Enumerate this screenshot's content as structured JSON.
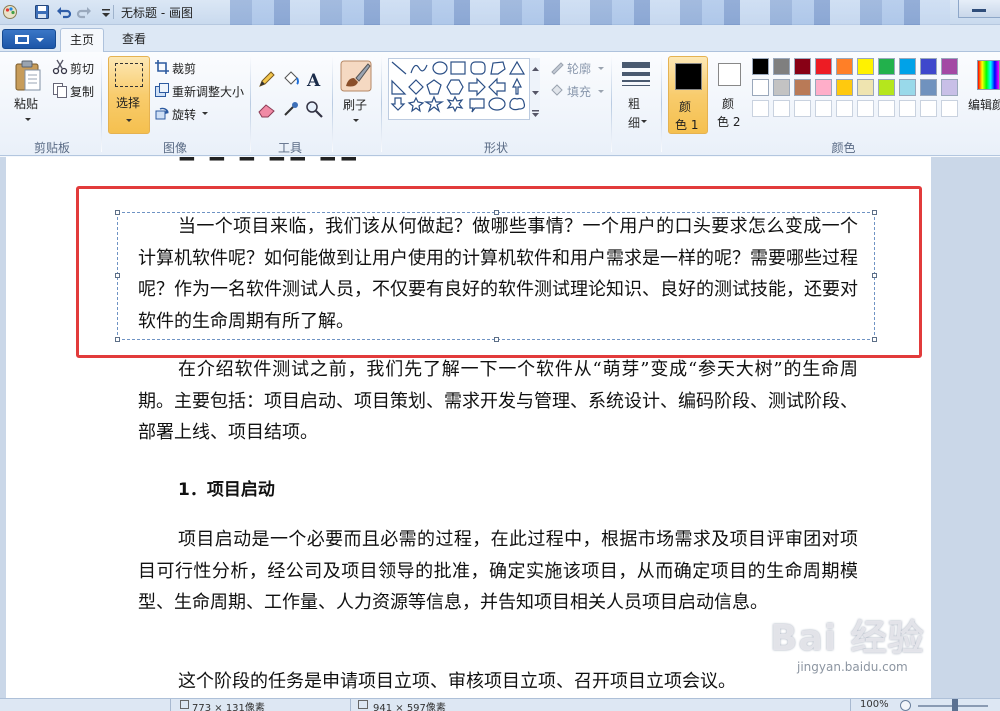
{
  "window": {
    "title": "无标题 - 画图"
  },
  "tabs": [
    {
      "label": "主页",
      "active": true
    },
    {
      "label": "查看",
      "active": false
    }
  ],
  "ribbon": {
    "clipboard": {
      "paste": "粘贴",
      "cut": "剪切",
      "copy": "复制",
      "group_label": "剪贴板"
    },
    "image": {
      "select": "选择",
      "crop": "裁剪",
      "resize": "重新调整大小",
      "rotate": "旋转",
      "group_label": "图像"
    },
    "tools": {
      "group_label": "工具"
    },
    "brushes": {
      "label": "刷子"
    },
    "shapes": {
      "outline": "轮廓",
      "fill": "填充",
      "group_label": "形状"
    },
    "size": {
      "label_line1": "粗",
      "label_line2": "细"
    },
    "colors": {
      "color1_line1": "颜",
      "color1_line2": "色 1",
      "color2_line1": "颜",
      "color2_line2": "色 2",
      "edit_colors": "编辑颜",
      "group_label": "颜色",
      "color1": "#000000",
      "color2": "#ffffff",
      "palette": [
        "#000000",
        "#7f7f7f",
        "#880015",
        "#ed1c24",
        "#ff7f27",
        "#fff200",
        "#22b14c",
        "#00a2e8",
        "#3f48cc",
        "#a349a4",
        "#ffffff",
        "#c3c3c3",
        "#b97a57",
        "#ffaec9",
        "#ffc90e",
        "#efe4b0",
        "#b5e61d",
        "#99d9ea",
        "#7092be",
        "#c8bfe7",
        "#ffffff",
        "#ffffff",
        "#ffffff",
        "#ffffff",
        "#ffffff",
        "#ffffff",
        "#ffffff",
        "#ffffff",
        "#ffffff",
        "#ffffff"
      ]
    }
  },
  "document": {
    "para1": "当一个项目来临，我们该从何做起？做哪些事情？一个用户的口头要求怎么变成一个计算机软件呢？如何能做到让用户使用的计算机软件和用户需求是一样的呢？需要哪些过程呢？作为一名软件测试人员，不仅要有良好的软件测试理论知识、良好的测试技能，还要对软件的生命周期有所了解。",
    "para2": "在介绍软件测试之前，我们先了解一下一个软件从“萌芽”变成“参天大树”的生命周期。主要包括：项目启动、项目策划、需求开发与管理、系统设计、编码阶段、测试阶段、部署上线、项目结项。",
    "heading1": "1．项目启动",
    "para3": "项目启动是一个必要而且必需的过程，在此过程中，根据市场需求及项目评审团对项目可行性分析，经公司及项目领导的批准，确定实施该项目，从而确定项目的生命周期模型、生命周期、工作量、人力资源等信息，并告知项目相关人员项目启动信息。",
    "para4": "这个阶段的任务是申请项目立项、审核项目立项、召开项目立项会议。"
  },
  "watermark": {
    "text": "Bai 经验",
    "sub": "jingyan.baidu.com"
  },
  "status": {
    "cursor_pos": "773 × 131像素",
    "image_size": "941 × 597像素",
    "zoom": "100%"
  }
}
